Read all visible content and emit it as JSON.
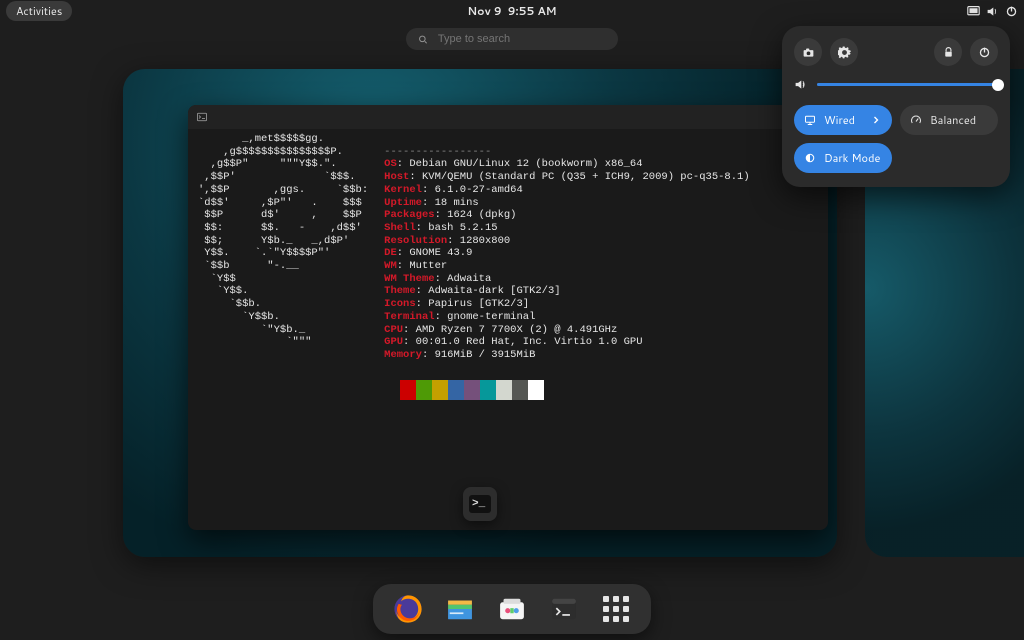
{
  "topbar": {
    "activities": "Activities",
    "date": "Nov 9",
    "time": "9:55 AM"
  },
  "search": {
    "placeholder": "Type to search"
  },
  "quick_settings": {
    "wired": "Wired",
    "balanced": "Balanced",
    "dark_mode": "Dark Mode",
    "volume_percent": 100
  },
  "neofetch": {
    "divider": "-----------------",
    "labels": {
      "os": "OS",
      "host": "Host",
      "kernel": "Kernel",
      "uptime": "Uptime",
      "packages": "Packages",
      "shell": "Shell",
      "resolution": "Resolution",
      "de": "DE",
      "wm": "WM",
      "wm_theme": "WM Theme",
      "theme": "Theme",
      "icons": "Icons",
      "terminal": "Terminal",
      "cpu": "CPU",
      "gpu": "GPU",
      "memory": "Memory"
    },
    "values": {
      "os": "Debian GNU/Linux 12 (bookworm) x86_64",
      "host": "KVM/QEMU (Standard PC (Q35 + ICH9, 2009) pc-q35-8.1)",
      "kernel": "6.1.0-27-amd64",
      "uptime": "18 mins",
      "packages": "1624 (dpkg)",
      "shell": "bash 5.2.15",
      "resolution": "1280x800",
      "de": "GNOME 43.9",
      "wm": "Mutter",
      "wm_theme": "Adwaita",
      "theme": "Adwaita-dark [GTK2/3]",
      "icons": "Papirus [GTK2/3]",
      "terminal": "gnome-terminal",
      "cpu": "AMD Ryzen 7 7700X (2) @ 4.491GHz",
      "gpu": "00:01.0 Red Hat, Inc. Virtio 1.0 GPU",
      "memory": "916MiB / 3915MiB"
    },
    "swatch_colors": [
      "#1a1a1a",
      "#cc0000",
      "#4e9a06",
      "#c4a000",
      "#3465a4",
      "#75507b",
      "#06989a",
      "#d3d7cf",
      "#555753",
      "#ffffff"
    ]
  },
  "ascii_art": "       _,met$$$$$gg.\n    ,g$$$$$$$$$$$$$$$P.\n  ,g$$P\"     \"\"\"Y$$.\".\n ,$$P'              `$$$.\n',$$P       ,ggs.     `$$b:\n`d$$'     ,$P\"'   .    $$$\n $$P      d$'     ,    $$P\n $$:      $$.   -    ,d$$'\n $$;      Y$b._   _,d$P'\n Y$$.    `.`\"Y$$$$P\"'\n `$$b      \"-.__\n  `Y$$\n   `Y$$.\n     `$$b.\n       `Y$$b.\n          `\"Y$b._\n              `\"\"\"",
  "dash": {
    "apps": [
      "firefox",
      "files",
      "software",
      "terminal",
      "show-apps"
    ]
  }
}
